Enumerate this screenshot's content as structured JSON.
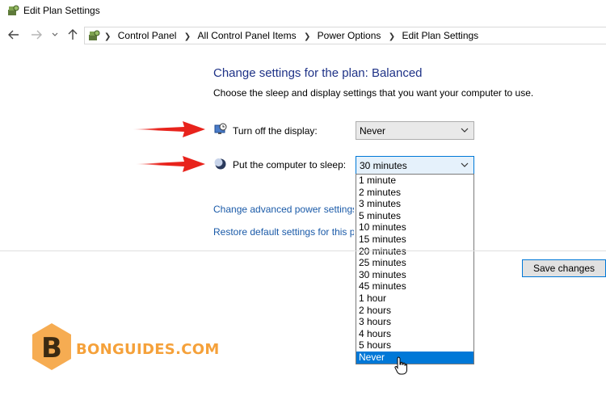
{
  "window": {
    "title": "Edit Plan Settings",
    "icon": "power-options-icon"
  },
  "addressbar": {
    "back_icon": "back-arrow-icon",
    "forward_icon": "forward-arrow-icon",
    "recent_icon": "chevron-down-icon",
    "up_icon": "up-arrow-icon",
    "location_icon": "control-panel-icon",
    "breadcrumbs": [
      "Control Panel",
      "All Control Panel Items",
      "Power Options",
      "Edit Plan Settings"
    ]
  },
  "main": {
    "heading": "Change settings for the plan: Balanced",
    "description": "Choose the sleep and display settings that you want your computer to use.",
    "display": {
      "label": "Turn off the display:",
      "icon": "monitor-clock-icon",
      "value": "Never"
    },
    "sleep": {
      "label": "Put the computer to sleep:",
      "icon": "moon-icon",
      "value": "30 minutes",
      "options": [
        "1 minute",
        "2 minutes",
        "3 minutes",
        "5 minutes",
        "10 minutes",
        "15 minutes",
        "20 minutes",
        "25 minutes",
        "30 minutes",
        "45 minutes",
        "1 hour",
        "2 hours",
        "3 hours",
        "4 hours",
        "5 hours",
        "Never"
      ],
      "highlighted_option": "Never"
    },
    "links": {
      "advanced": "Change advanced power settings",
      "restore": "Restore default settings for this plan"
    },
    "save_label": "Save changes"
  },
  "watermark": {
    "text": "BONGUIDES.COM",
    "letter": "B"
  },
  "colors": {
    "heading": "#1e3287",
    "link": "#1a5aa8",
    "accent": "#0078d7",
    "arrow": "#e8231c",
    "watermark": "#f5a13a"
  }
}
